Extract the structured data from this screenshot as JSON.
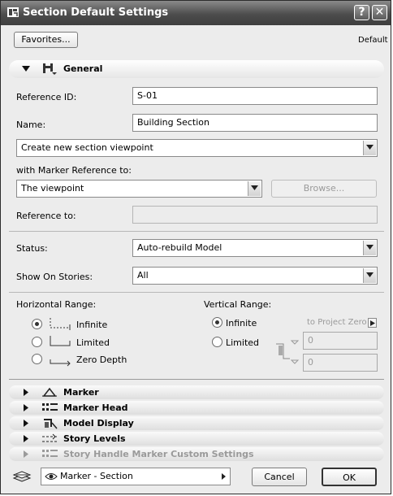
{
  "window": {
    "title": "Section Default Settings",
    "help_glyph": "?",
    "close_glyph": "✕"
  },
  "toolbar": {
    "favorites_label": "Favorites...",
    "default_label": "Default"
  },
  "general": {
    "header_label": "General",
    "reference_id": {
      "label": "Reference ID:",
      "value": "S-01"
    },
    "name": {
      "label": "Name:",
      "value": "Building Section"
    },
    "viewpoint_select": "Create new section viewpoint",
    "marker_reference_label": "with Marker Reference to:",
    "marker_reference_select": "The viewpoint",
    "browse_label": "Browse...",
    "reference_to_label": "Reference to:",
    "reference_to_value": "",
    "status": {
      "label": "Status:",
      "value": "Auto-rebuild Model"
    },
    "show_on_stories": {
      "label": "Show On Stories:",
      "value": "All"
    }
  },
  "horizontal_range": {
    "label": "Horizontal Range:",
    "options": [
      "Infinite",
      "Limited",
      "Zero Depth"
    ],
    "selected": "Infinite"
  },
  "vertical_range": {
    "label": "Vertical Range:",
    "options": [
      "Infinite",
      "Limited"
    ],
    "selected": "Infinite",
    "to_project_zero": "to Project Zero",
    "top_value": "0",
    "bottom_value": "0"
  },
  "panels": [
    {
      "label": "Marker",
      "icon": "marker-icon",
      "enabled": true
    },
    {
      "label": "Marker Head",
      "icon": "marker-head-icon",
      "enabled": true
    },
    {
      "label": "Model Display",
      "icon": "model-display-icon",
      "enabled": true
    },
    {
      "label": "Story Levels",
      "icon": "story-levels-icon",
      "enabled": true
    },
    {
      "label": "Story Handle Marker Custom Settings",
      "icon": "story-handle-icon",
      "enabled": false
    }
  ],
  "footer": {
    "layer_select": "Marker - Section",
    "cancel_label": "Cancel",
    "ok_label": "OK"
  },
  "colors": {
    "titlebar": "#4d4d4d",
    "dialog_bg": "#ececec"
  }
}
